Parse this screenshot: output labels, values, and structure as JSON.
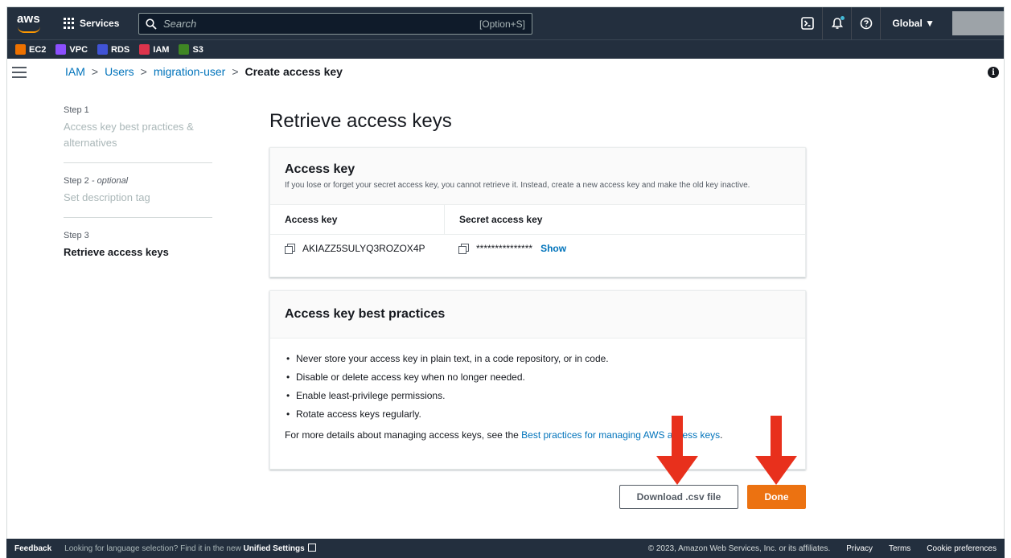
{
  "nav": {
    "logo": "aws",
    "services": "Services",
    "search_placeholder": "Search",
    "search_hint": "[Option+S]",
    "region": "Global ▼"
  },
  "favorites": [
    {
      "label": "EC2",
      "color": "#ed7100"
    },
    {
      "label": "VPC",
      "color": "#8c4fff"
    },
    {
      "label": "RDS",
      "color": "#4053d6"
    },
    {
      "label": "IAM",
      "color": "#dd344c"
    },
    {
      "label": "S3",
      "color": "#3f8624"
    }
  ],
  "breadcrumb": {
    "iam": "IAM",
    "users": "Users",
    "user": "migration-user",
    "current": "Create access key",
    "sep": ">"
  },
  "steps": [
    {
      "num": "Step 1",
      "title": "Access key best practices & alternatives"
    },
    {
      "num": "Step 2",
      "optional": "- optional",
      "title": "Set description tag"
    },
    {
      "num": "Step 3",
      "title": "Retrieve access keys"
    }
  ],
  "page_title": "Retrieve access keys",
  "access_key_panel": {
    "title": "Access key",
    "description": "If you lose or forget your secret access key, you cannot retrieve it. Instead, create a new access key and make the old key inactive.",
    "col_access_key": "Access key",
    "col_secret": "Secret access key",
    "access_key_value": "AKIAZZ5SULYQ3ROZOX4P",
    "secret_value": "***************",
    "show_label": "Show"
  },
  "best_practices": {
    "title": "Access key best practices",
    "items": [
      "Never store your access key in plain text, in a code repository, or in code.",
      "Disable or delete access key when no longer needed.",
      "Enable least-privilege permissions.",
      "Rotate access keys regularly."
    ],
    "more_prefix": "For more details about managing access keys, see the ",
    "more_link": "Best practices for managing AWS access keys",
    "more_suffix": "."
  },
  "buttons": {
    "download": "Download .csv file",
    "done": "Done"
  },
  "footer": {
    "feedback": "Feedback",
    "lang_prefix": "Looking for language selection? Find it in the new ",
    "lang_link": "Unified Settings",
    "copyright": "© 2023, Amazon Web Services, Inc. or its affiliates.",
    "privacy": "Privacy",
    "terms": "Terms",
    "cookies": "Cookie preferences"
  },
  "colors": {
    "nav_bg": "#232f3e",
    "link": "#0073bb",
    "primary_button": "#ec7211",
    "annotation_arrow": "#e8301c"
  }
}
